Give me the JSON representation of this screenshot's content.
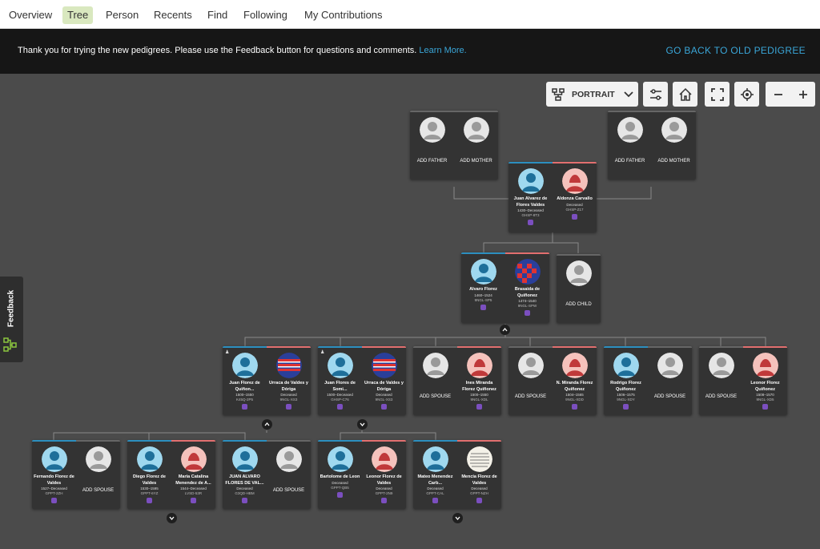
{
  "nav": {
    "tabs": [
      {
        "label": "Overview"
      },
      {
        "label": "Tree"
      },
      {
        "label": "Person"
      },
      {
        "label": "Recents"
      },
      {
        "label": "Find"
      },
      {
        "label": "Following"
      },
      {
        "label": "My Contributions"
      }
    ],
    "active_tab": "Tree"
  },
  "banner": {
    "text": "Thank you for trying the new pedigrees. Please use the Feedback button for questions and comments.",
    "link": "Learn More.",
    "back_link": "GO BACK TO OLD PEDIGREE"
  },
  "toolbar": {
    "layout_label": "PORTRAIT",
    "icons": [
      "tree-layout-icon",
      "chevron-down-icon",
      "sliders-icon",
      "home-icon",
      "fullscreen-icon",
      "target-icon",
      "minus-icon",
      "plus-icon"
    ]
  },
  "feedback": {
    "label": "Feedback"
  },
  "labels": {
    "add_father": "ADD FATHER",
    "add_mother": "ADD MOTHER",
    "add_child": "ADD CHILD",
    "add_spouse": "ADD SPOUSE"
  },
  "colors": {
    "male": "#2c8fbf",
    "female": "#e26f6f",
    "link": "#3aa6d8",
    "active_tab": "#d9e8bf"
  },
  "people": {
    "p_juan_alvarez": {
      "name": "Juan Alvarez de Flores Valdes",
      "life": "1430–Deceased",
      "id": "GHSP-8T3"
    },
    "p_aldonza": {
      "name": "Aldonza Carvallo",
      "life": "Deceased",
      "id": "GHSP-Z17"
    },
    "p_alvaro": {
      "name": "Alvaro Florez",
      "life": "1460–1524",
      "id": "9NGL-SP5"
    },
    "p_brasaida": {
      "name": "Brasaida de Quiñonez",
      "life": "1474–1540",
      "id": "9NGL-SPW"
    },
    "p_juan1": {
      "name": "Juan Florez de Quiñon...",
      "life": "1500–1550",
      "id": "K45Q-2P5"
    },
    "p_urraca1": {
      "name": "Urraca de Valdes y Dóriga",
      "life": "Deceased",
      "id": "9NGL-XS3"
    },
    "p_juan2": {
      "name": "Juan Flores de Somi...",
      "life": "1500–Deceased",
      "id": "GHSP-C76"
    },
    "p_urraca2": {
      "name": "Urraca de Valdes y Dóriga",
      "life": "Deceased",
      "id": "9NGL-XS3"
    },
    "p_ines": {
      "name": "Ines Miranda Florez Quiñonez",
      "life": "1500–1550",
      "id": "9NGL-XDL"
    },
    "p_nmiranda": {
      "name": "N. Miranda Florez Quiñonez",
      "life": "1504–1565",
      "id": "9NGL-XDD"
    },
    "p_rodrigo": {
      "name": "Rodrigo Florez Quiñonez",
      "life": "1506–1575",
      "id": "9NGL-XDY"
    },
    "p_leonor1": {
      "name": "Leonor Florez Quiñonez",
      "life": "1508–1570",
      "id": "9NGL-XD5"
    },
    "p_fernando": {
      "name": "Fernando Florez de Valdes",
      "life": "1527–Deceased",
      "id": "GPPT-2ZH"
    },
    "p_diego": {
      "name": "Diego Florez de Valdes",
      "life": "1530–1595",
      "id": "GPPT-6YZ"
    },
    "p_maria": {
      "name": "Maria Catalina Menendez de A...",
      "life": "1544–Deceased",
      "id": "LVSD-53R"
    },
    "p_juan_alvaro": {
      "name": "JUAN ALVARO FLORES DE VAL...",
      "life": "Deceased",
      "id": "G3QD-HBM"
    },
    "p_bartolome": {
      "name": "Bartolome de Leon",
      "life": "Deceased",
      "id": "GPPT-QB5"
    },
    "p_leonor2": {
      "name": "Leonor Florez de Valdes",
      "life": "Deceased",
      "id": "GPPT-2N9"
    },
    "p_mateo": {
      "name": "Mateo Menendez Carb...",
      "life": "Deceased",
      "id": "GPPT-CAL"
    },
    "p_mencia": {
      "name": "Mencia Florez de Valdes",
      "life": "Deceased",
      "id": "GPPT-NZH"
    }
  }
}
